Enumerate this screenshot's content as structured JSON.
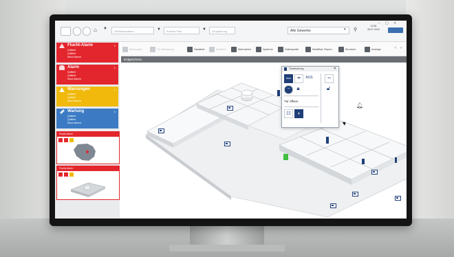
{
  "topbar": {
    "dropdown_1": "Gebäudeaufbau",
    "dropdown_2": "Ansicht Plan",
    "dropdown_3": "Gruppierung",
    "trade_select": "Alle Gewerke",
    "time": "13:55",
    "date": "28.07.2020"
  },
  "toolbar": {
    "items": [
      {
        "label": "Meldungen",
        "enabled": false
      },
      {
        "label": "Tür-Steuerung",
        "enabled": false
      },
      {
        "label": "Handbetr.",
        "enabled": true
      },
      {
        "label": "Funktion",
        "enabled": false
      },
      {
        "label": "Maßnahme",
        "enabled": true
      },
      {
        "label": "Systeme",
        "enabled": true
      },
      {
        "label": "Datenquelle",
        "enabled": true
      },
      {
        "label": "Modifikat. Report",
        "enabled": true
      },
      {
        "label": "Benutzer",
        "enabled": true
      },
      {
        "label": "Anzeige",
        "enabled": true
      }
    ]
  },
  "sidebar": {
    "alarms": [
      {
        "title": "Flucht-Alarm",
        "color": "#e3262d",
        "rows": [
          "Quittiert",
          "Quittiert",
          "Neue Alarme"
        ],
        "count": "1"
      },
      {
        "title": "Alarm",
        "color": "#e3262d",
        "rows": [
          "Quittiert",
          "Quittiert",
          "Neue Alarme"
        ],
        "count": "1"
      },
      {
        "title": "Warnungen",
        "color": "#f0b90b",
        "rows": [
          "Quittiert",
          "Quittiert",
          "Neue Alarme"
        ],
        "count": "1"
      },
      {
        "title": "Wartung",
        "color": "#3c7bc4",
        "rows": [
          "Quittiert",
          "Quittiert",
          "Neue Alarme"
        ],
        "count": "1"
      }
    ],
    "cards": [
      {
        "header": "Flucht-Alarm"
      },
      {
        "header": "Flucht-Alarm"
      }
    ]
  },
  "main": {
    "floor_label": "Erdgeschoss"
  },
  "popup": {
    "title": "Türsteuerung",
    "auto": "Auto",
    "aus": "AUS",
    "open_label": "Tür öffnen"
  },
  "colors": {
    "alarm_red": "#e3262d",
    "warning_yellow": "#f0b90b",
    "maintenance_blue": "#3c7bc4",
    "door_navy": "#1f3f78"
  }
}
